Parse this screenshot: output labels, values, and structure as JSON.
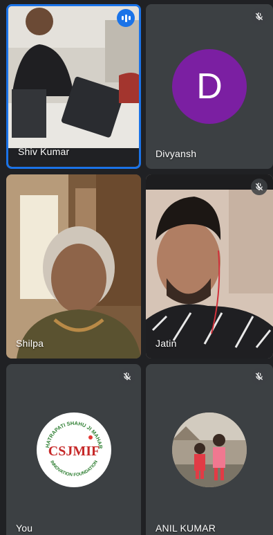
{
  "participants": [
    {
      "name": "Shiv Kumar"
    },
    {
      "name": "Divyansh",
      "initial": "D"
    },
    {
      "name": "Shilpa"
    },
    {
      "name": "Jatin"
    },
    {
      "name": "You",
      "logo_text": {
        "top": "CHHATRAPATI SHAHU JI MAHARAJ",
        "center": "CSJMIF",
        "bottom": "INNOVATION FOUNDATION"
      }
    },
    {
      "name": "ANIL KUMAR"
    }
  ],
  "colors": {
    "background": "#202124",
    "tile": "#3c4043",
    "active_border": "#1a73e8",
    "avatar_purple": "#7b1fa2"
  },
  "icons": {
    "speaking": "audio-wave-icon",
    "muted": "mic-off-icon"
  }
}
